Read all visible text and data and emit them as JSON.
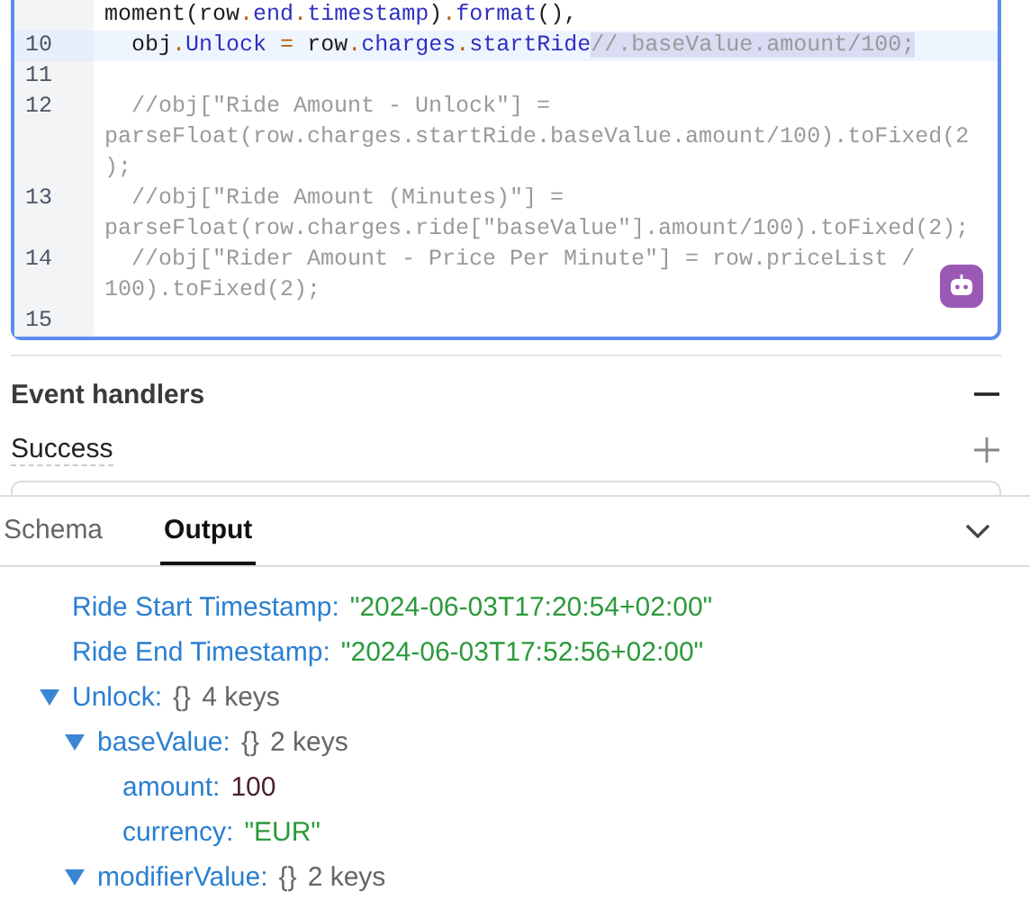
{
  "editor": {
    "lines": [
      {
        "current": false,
        "rows": [
          [
            {
              "kind": "text",
              "text": "moment(row",
              "selected": false
            },
            {
              "kind": "op",
              "text": ".",
              "selected": false
            },
            {
              "kind": "prop",
              "text": "end",
              "selected": false
            },
            {
              "kind": "op",
              "text": ".",
              "selected": false
            },
            {
              "kind": "prop",
              "text": "timestamp",
              "selected": false
            },
            {
              "kind": "text",
              "text": ")",
              "selected": false
            },
            {
              "kind": "op",
              "text": ".",
              "selected": false
            },
            {
              "kind": "prop",
              "text": "format",
              "selected": false
            },
            {
              "kind": "text",
              "text": "(),",
              "selected": false
            }
          ]
        ]
      },
      {
        "number": "10",
        "current": true,
        "rows": [
          [
            {
              "kind": "text",
              "text": "  obj",
              "selected": false
            },
            {
              "kind": "op",
              "text": ".",
              "selected": false
            },
            {
              "kind": "prop",
              "text": "Unlock",
              "selected": false
            },
            {
              "kind": "op",
              "text": " = ",
              "selected": false
            },
            {
              "kind": "text",
              "text": "row",
              "selected": false
            },
            {
              "kind": "op",
              "text": ".",
              "selected": false
            },
            {
              "kind": "prop",
              "text": "charges",
              "selected": false
            },
            {
              "kind": "op",
              "text": ".",
              "selected": false
            },
            {
              "kind": "prop",
              "text": "startRide",
              "selected": false
            },
            {
              "kind": "comment",
              "text": "//.baseValue.amount/100;",
              "selected": true
            }
          ]
        ]
      },
      {
        "number": "11",
        "current": false
      },
      {
        "number": "12",
        "current": false,
        "rows": [
          [
            {
              "kind": "comment",
              "text": "  //obj[\"Ride Amount - Unlock\"] =",
              "selected": false
            }
          ],
          [
            {
              "kind": "comment",
              "text": "parseFloat(row.charges.startRide.baseValue.amount/100).toFixed(2",
              "selected": false
            }
          ],
          [
            {
              "kind": "comment",
              "text": ");",
              "selected": false
            }
          ]
        ]
      },
      {
        "number": "13",
        "current": false,
        "rows": [
          [
            {
              "kind": "comment",
              "text": "  //obj[\"Ride Amount (Minutes)\"] =",
              "selected": false
            }
          ],
          [
            {
              "kind": "comment",
              "text": "parseFloat(row.charges.ride[\"baseValue\"].amount/100).toFixed(2);",
              "selected": false
            }
          ]
        ]
      },
      {
        "number": "14",
        "current": false,
        "rows": [
          [
            {
              "kind": "comment",
              "text": "  //obj[\"Rider Amount - Price Per Minute\"] = row.priceList /",
              "selected": false
            }
          ],
          [
            {
              "kind": "comment",
              "text": "100).toFixed(2);",
              "selected": false
            }
          ]
        ]
      },
      {
        "number": "15",
        "current": false
      }
    ]
  },
  "sections": [
    {
      "title": "Event handlers",
      "expanded": true
    }
  ],
  "handlers": [
    {
      "label": "Success",
      "expanded": false
    }
  ],
  "tabs": [
    {
      "label": "Schema",
      "selected": false
    },
    {
      "label": "Output",
      "selected": true
    }
  ],
  "tree": [
    {
      "key": "Ride Start Timestamp:",
      "value": "\"2024-06-03T17:20:54+02:00\"",
      "kind": "string"
    },
    {
      "key": "Ride End Timestamp:",
      "value": "\"2024-06-03T17:52:56+02:00\"",
      "kind": "string"
    },
    {
      "key": "Unlock:",
      "kind": "object",
      "expanded": true,
      "braces": "{}",
      "count": "4 keys",
      "children": [
        {
          "key": "baseValue:",
          "kind": "object",
          "expanded": true,
          "braces": "{}",
          "count": "2 keys",
          "children": [
            {
              "key": "amount:",
              "value": "100",
              "kind": "number"
            },
            {
              "key": "currency:",
              "value": "\"EUR\"",
              "kind": "string"
            }
          ]
        },
        {
          "key": "modifierValue:",
          "kind": "object",
          "expanded": true,
          "braces": "{}",
          "count": "2 keys"
        }
      ]
    }
  ]
}
